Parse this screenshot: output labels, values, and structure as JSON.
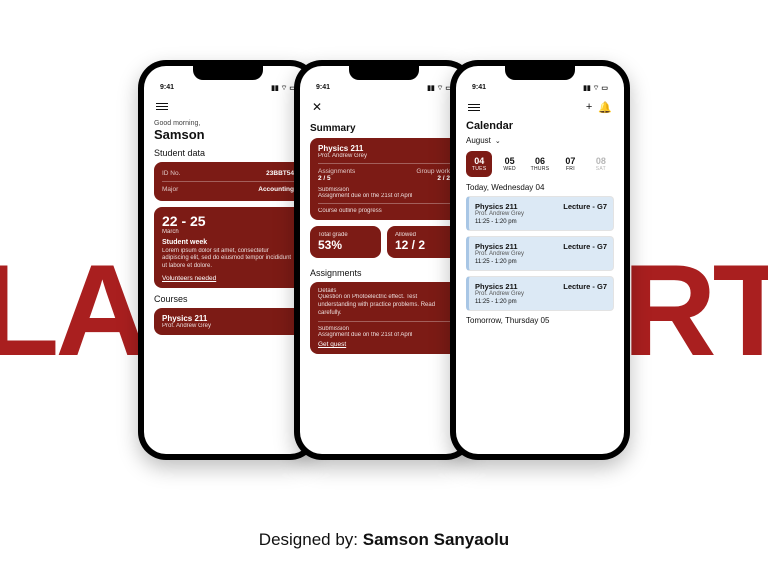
{
  "background_text": {
    "left": "LAS",
    "right": "ORT"
  },
  "status_time": "9:41",
  "colors": {
    "brand": "#7c1b15",
    "accent_bg": "#dce9f5"
  },
  "phone1": {
    "greeting": "Good morning,",
    "name": "Samson",
    "section_student": "Student data",
    "id_label": "ID No.",
    "id_value": "23BBT54",
    "major_label": "Major",
    "major_value": "Accounting",
    "event_range": "22 - 25",
    "event_month": "March",
    "event_title": "Student week",
    "event_body": "Lorem ipsum dolor sit amet, consectetur adipiscing elit, sed do eiusmod tempor incididunt ut labore et dolore.",
    "event_link": "Volunteers needed",
    "section_courses": "Courses",
    "course_title": "Physics 211",
    "course_prof": "Prof. Andrew Grey"
  },
  "phone2": {
    "title": "Summary",
    "course_title": "Physics 211",
    "course_prof": "Prof. Andrew Grey",
    "assign_label": "Assignments",
    "assign_val": "2 / 5",
    "group_label": "Group work",
    "group_val": "2 / 2",
    "sub_label": "Submission",
    "sub_text": "Assignment due on the 21st of April",
    "outline_label": "Course outline progress",
    "grade_label": "Total grade",
    "grade_val": "53%",
    "allow_label": "Allowed",
    "allow_val": "12 / 2",
    "section_assign": "Assignments",
    "details_label": "Details",
    "details_text": "Question on Photoelectric effect. Test understanding with practice problems. Read carefully.",
    "sub2_label": "Submission",
    "sub2_text": "Assignment due on the 21st of April",
    "get_link": "Get quest"
  },
  "phone3": {
    "title": "Calendar",
    "month": "August",
    "dates": [
      {
        "n": "04",
        "w": "TUES",
        "sel": true
      },
      {
        "n": "05",
        "w": "WED"
      },
      {
        "n": "06",
        "w": "THURS"
      },
      {
        "n": "07",
        "w": "FRI"
      },
      {
        "n": "08",
        "w": "SAT",
        "pale": true
      }
    ],
    "today_h": "Today, Wednesday 04",
    "events": [
      {
        "title": "Physics 211",
        "tag": "Lecture - G7",
        "prof": "Prof. Andrew Grey",
        "time": "11:25 - 1:20 pm"
      },
      {
        "title": "Physics 211",
        "tag": "Lecture - G7",
        "prof": "Prof. Andrew Grey",
        "time": "11:25 - 1:20 pm"
      },
      {
        "title": "Physics 211",
        "tag": "Lecture - G7",
        "prof": "Prof. Andrew Grey",
        "time": "11:25 - 1:20 pm"
      }
    ],
    "tomorrow_h": "Tomorrow, Thursday 05"
  },
  "credit_prefix": "Designed by: ",
  "credit_name": "Samson Sanyaolu"
}
